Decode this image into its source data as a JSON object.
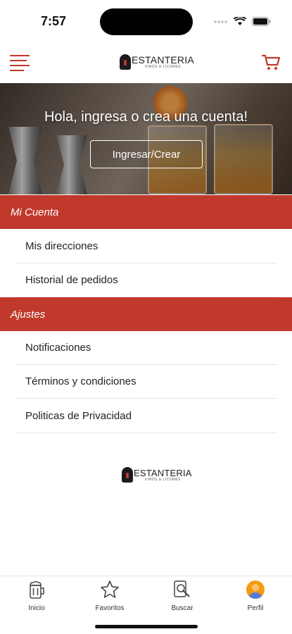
{
  "status_bar": {
    "time": "7:57"
  },
  "header": {
    "logo_text": "ESTANTERIA",
    "logo_sub": "VINOS & LICORES"
  },
  "hero": {
    "title": "Hola, ingresa o crea una cuenta!",
    "button_label": "Ingresar/Crear"
  },
  "sections": [
    {
      "title": "Mi Cuenta",
      "items": [
        "Mis direcciones",
        "Historial de pedidos"
      ]
    },
    {
      "title": "Ajustes",
      "items": [
        "Notificaciones",
        "Términos y condiciones",
        "Politicas de Privacidad"
      ]
    }
  ],
  "footer": {
    "logo_text": "ESTANTERIA",
    "logo_sub": "VINOS & LICORES"
  },
  "tabs": [
    {
      "label": "Inicio",
      "icon": "beer-mug-icon"
    },
    {
      "label": "Favoritos",
      "icon": "star-icon"
    },
    {
      "label": "Buscar",
      "icon": "search-icon"
    },
    {
      "label": "Perfil",
      "icon": "profile-avatar-icon"
    }
  ],
  "colors": {
    "accent": "#c0392b",
    "avatar_orange": "#f39c12",
    "avatar_blue": "#5b7bd6"
  }
}
